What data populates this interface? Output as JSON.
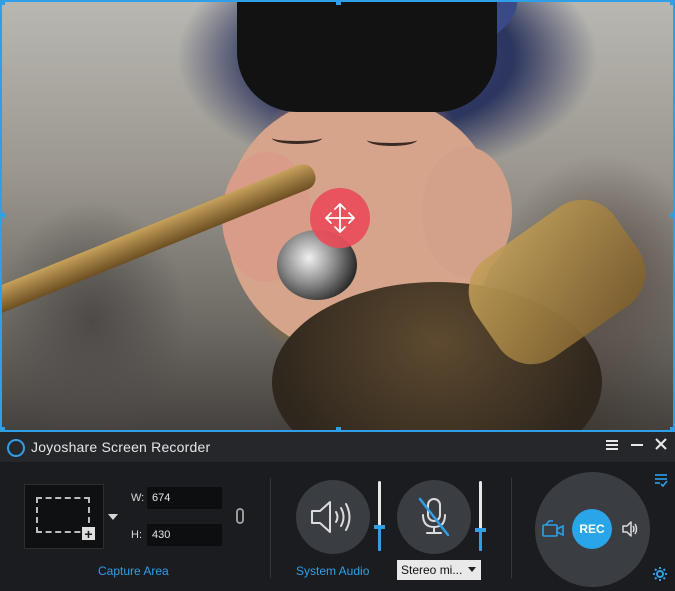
{
  "app": {
    "title": "Joyoshare Screen Recorder",
    "accent_color": "#2f9fe8",
    "rec_color": "#29a6ea",
    "move_handle_color": "#e94c5a"
  },
  "window_controls": {
    "menu_icon": "menu-icon",
    "minimize_icon": "minimize-icon",
    "close_icon": "close-icon"
  },
  "capture_area": {
    "label": "Capture Area",
    "width_label": "W:",
    "width_value": "674",
    "height_label": "H:",
    "height_value": "430"
  },
  "system_audio": {
    "label": "System Audio",
    "volume_level": 0.35
  },
  "microphone": {
    "selected": "Stereo mi...",
    "muted": true,
    "volume_level": 0.3
  },
  "record": {
    "label": "REC"
  }
}
